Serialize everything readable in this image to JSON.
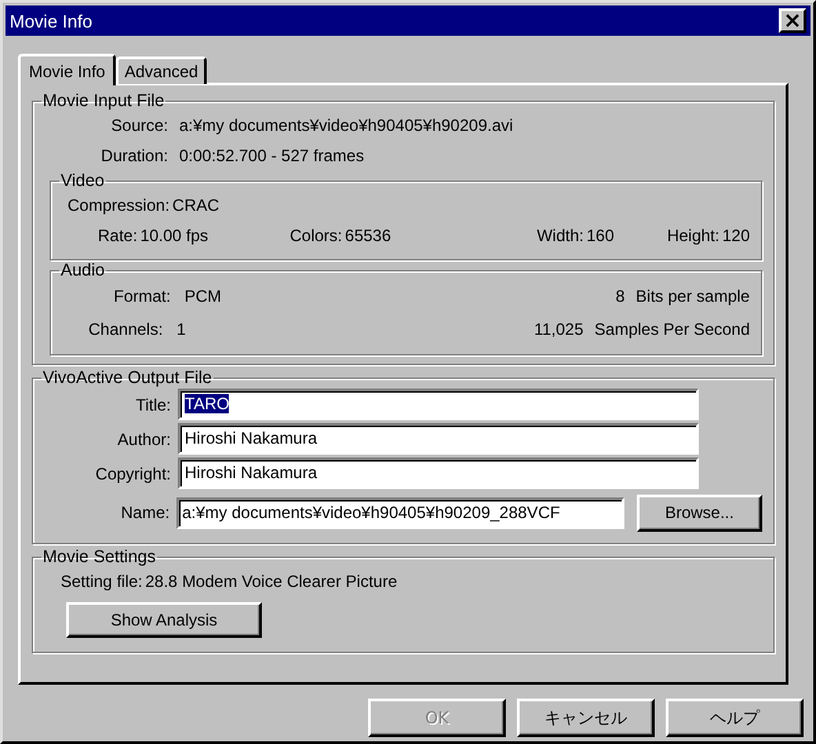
{
  "window": {
    "title": "Movie Info",
    "close": "×"
  },
  "tabs": [
    {
      "label": "Movie Info",
      "selected": true
    },
    {
      "label": "Advanced",
      "selected": false
    }
  ],
  "input_file": {
    "title": "Movie Input File",
    "rows": [
      {
        "label": "Source:",
        "value": "a:¥my documents¥video¥h90405¥h90209.avi"
      },
      {
        "label": "Duration:",
        "value": "0:00:52.700 - 527 frames"
      }
    ]
  },
  "video": {
    "title": "Video",
    "compression": {
      "label": "Compression:",
      "value": "CRAC"
    },
    "stats": [
      {
        "label": "Rate:",
        "value": "10.00 fps"
      },
      {
        "label": "Colors:",
        "value": "65536"
      },
      {
        "label": "Width:",
        "value": "160"
      },
      {
        "label": "Height:",
        "value": "120"
      }
    ]
  },
  "audio": {
    "title": "Audio",
    "rows": [
      {
        "label": "Format:",
        "value": "PCM",
        "right_value": "8",
        "right_label": "Bits per sample"
      },
      {
        "label": "Channels:",
        "value": "1",
        "right_value": "11,025",
        "right_label": "Samples Per Second"
      }
    ]
  },
  "output_file": {
    "title": "VivoActive Output File",
    "fields": [
      {
        "label": "Title:",
        "value": "TARO",
        "selected": true
      },
      {
        "label": "Author:",
        "value": "Hiroshi Nakamura",
        "selected": false
      },
      {
        "label": "Copyright:",
        "value": "Hiroshi Nakamura",
        "selected": false
      }
    ],
    "name": {
      "label": "Name:",
      "value": "a:¥my documents¥video¥h90405¥h90209_288VCF"
    },
    "browse": {
      "label": "Browse..."
    }
  },
  "settings": {
    "title": "Movie Settings",
    "label": "Setting file:",
    "value": "28.8 Modem Voice Clearer Picture",
    "button": {
      "label": "Show Analysis"
    }
  },
  "buttons": [
    {
      "label": "OK",
      "disabled": true
    },
    {
      "label": "キャンセル",
      "disabled": false
    },
    {
      "label": "ヘルプ",
      "disabled": false
    }
  ]
}
